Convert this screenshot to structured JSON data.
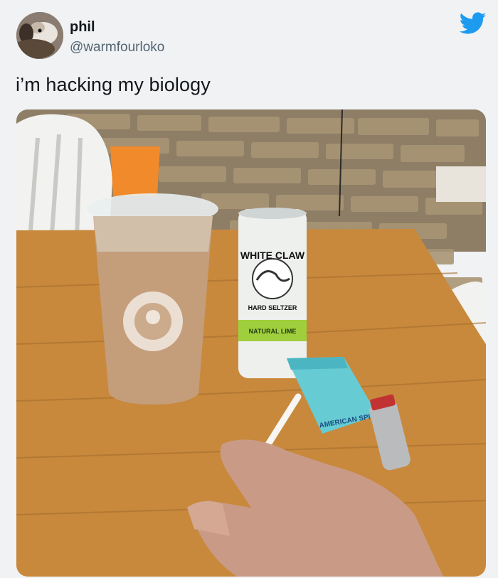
{
  "tweet": {
    "user": {
      "name": "phil",
      "handle": "@warmfourloko",
      "avatar_icon": "avatar-photo"
    },
    "text": "i’m hacking my biology",
    "logo_icon": "twitter-bird-icon",
    "brand_color": "#1d9bf0",
    "media": {
      "type": "photo",
      "can_text": [
        "WHITE CLAW",
        "HARD SELTZER",
        "NATURAL LIME"
      ],
      "pack_text": [
        "AMERICAN SPIRIT"
      ]
    }
  }
}
